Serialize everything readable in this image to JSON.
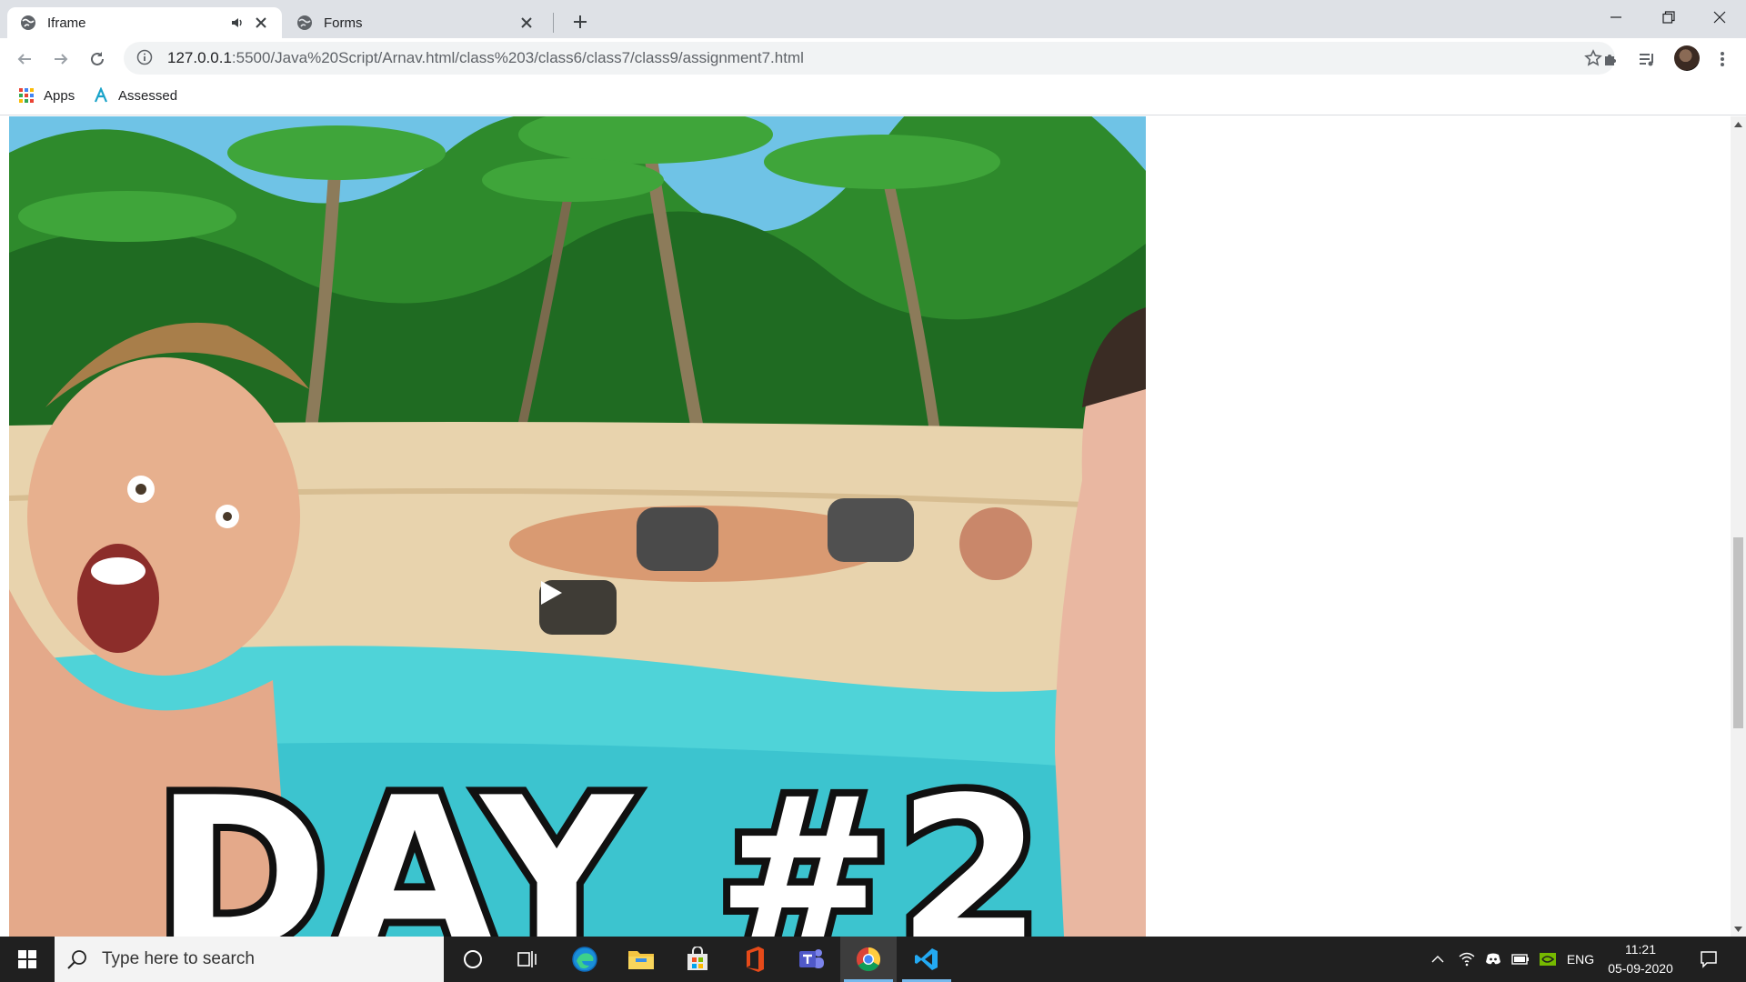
{
  "browser": {
    "tabs": [
      {
        "title": "Iframe",
        "active": true,
        "muted_icon": "speaker-icon"
      },
      {
        "title": "Forms",
        "active": false
      }
    ],
    "address": {
      "host": "127.0.0.1",
      "rest": ":5500/Java%20Script/Arnav.html/class%203/class6/class7/class9/assignment7.html"
    },
    "bookmarks": [
      {
        "label": "Apps",
        "icon": "apps-grid-icon"
      },
      {
        "label": "Assessed",
        "icon": "assessed-logo-icon"
      }
    ]
  },
  "video": {
    "overlay_text": "DAY #2"
  },
  "taskbar": {
    "search_placeholder": "Type here to search",
    "language": "ENG",
    "time": "11:21",
    "date": "05-09-2020"
  },
  "colors": {
    "tabstrip": "#dee1e6",
    "taskbar": "#202020",
    "accent": "#76b9ed"
  }
}
